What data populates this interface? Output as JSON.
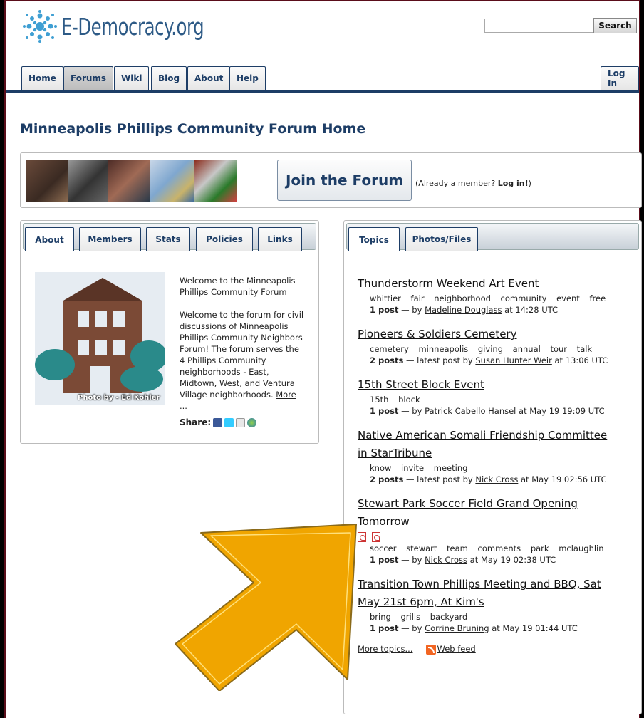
{
  "site": {
    "logo_text": "E-Democracy.org"
  },
  "search": {
    "button_label": "Search",
    "placeholder": ""
  },
  "nav": {
    "tabs": [
      {
        "label": "Home"
      },
      {
        "label": "Forums"
      },
      {
        "label": "Wiki"
      },
      {
        "label": "Blog"
      },
      {
        "label": "About"
      },
      {
        "label": "Help"
      }
    ],
    "active": "Forums",
    "login_label": "Log In"
  },
  "page": {
    "title": "Minneapolis Phillips Community Forum Home"
  },
  "banner": {
    "join_label": "Join the Forum",
    "already_prefix": "(Already a member?",
    "login_link": "Log in!",
    "already_suffix": ")"
  },
  "left_panel": {
    "tabs": [
      {
        "label": "About"
      },
      {
        "label": "Members"
      },
      {
        "label": "Stats"
      },
      {
        "label": "Policies"
      },
      {
        "label": "Links"
      }
    ],
    "active_tab": "About",
    "photo_caption": "Photo by - Ed Kohler",
    "intro": "Welcome to the Minneapolis Phillips Community Forum",
    "body": "Welcome to the forum for civil discussions of Minneapolis Phillips Community Neighbors Forum! The forum serves the 4 Phillips Community neighborhoods - East, Midtown, West, and Ventura Village neighborhoods.",
    "more_link": "More ...",
    "share_label": "Share:"
  },
  "right_panel": {
    "tabs": [
      {
        "label": "Topics"
      },
      {
        "label": "Photos/Files"
      }
    ],
    "active_tab": "Topics",
    "topics": [
      {
        "title": "Thunderstorm Weekend Art Event",
        "keywords": "whittier fair neighborhood community event free",
        "count": "1 post",
        "sep": " — by ",
        "author": "Madeline Douglass",
        "time": " at 14:28 UTC"
      },
      {
        "title": "Pioneers & Soldiers Cemetery",
        "keywords": "cemetery minneapolis giving annual tour talk",
        "count": "2 posts",
        "sep": " — latest post by ",
        "author": "Susan Hunter Weir",
        "time": " at 13:06 UTC"
      },
      {
        "title": "15th Street Block Event",
        "keywords": "15th block",
        "count": "1 post",
        "sep": " — by ",
        "author": "Patrick Cabello Hansel",
        "time": " at May 19 19:09 UTC"
      },
      {
        "title": "Native American Somali Friendship Committee in StarTribune",
        "keywords": "know invite meeting",
        "count": "2 posts",
        "sep": " — latest post by ",
        "author": "Nick Cross",
        "time": " at May 19 02:56 UTC"
      },
      {
        "title": "Stewart Park Soccer Field Grand Opening Tomorrow",
        "keywords": "soccer stewart team comments park mclaughlin",
        "count": "1 post",
        "sep": " — by ",
        "author": "Nick Cross",
        "time": " at May 19 02:38 UTC",
        "attachments": [
          "pdf-icon",
          "pdf-icon"
        ]
      },
      {
        "title": "Transition Town Phillips Meeting and BBQ, Sat May 21st 6pm, At Kim's",
        "keywords": "bring grills backyard",
        "count": "1 post",
        "sep": " — by ",
        "author": "Corrine Bruning",
        "time": " at May 19 01:44 UTC"
      }
    ],
    "more_topics": "More topics...",
    "web_feed": "Web feed"
  },
  "colors": {
    "brand": "#1d3d66",
    "arrow": "#f0a500"
  }
}
